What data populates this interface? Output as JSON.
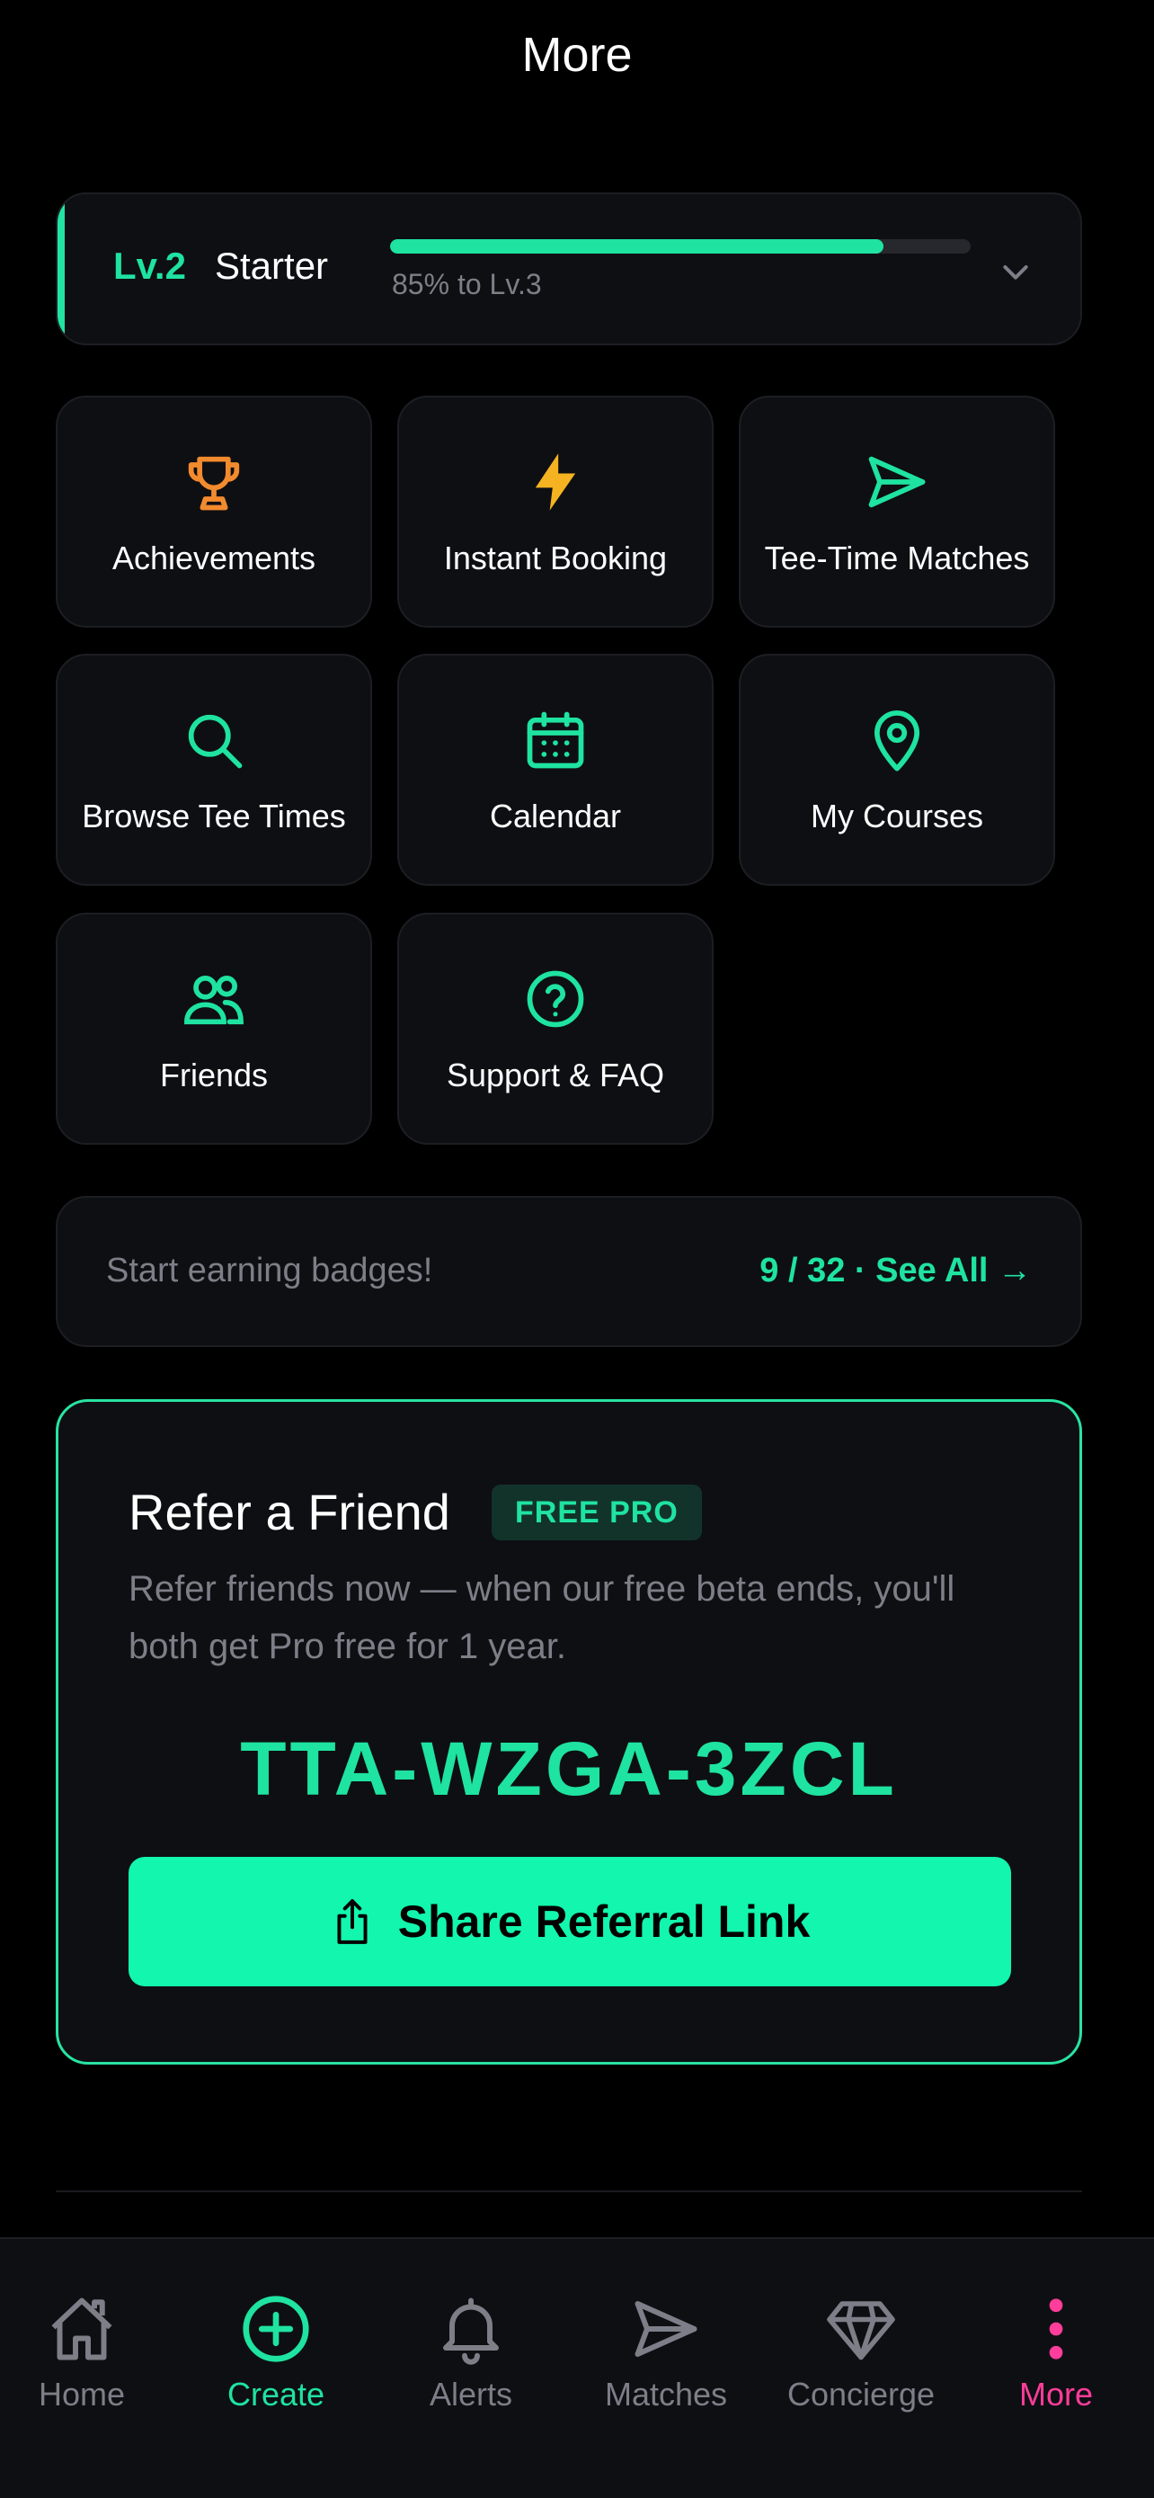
{
  "header": {
    "title": "More"
  },
  "level": {
    "level_label": "Lv.2",
    "level_name": "Starter",
    "progress_percent": 85,
    "progress_text": "85% to Lv.3"
  },
  "tiles": [
    {
      "label": "Achievements",
      "icon": "trophy-icon",
      "color": "#f28a2e"
    },
    {
      "label": "Instant Booking",
      "icon": "lightning-icon",
      "color": "#f5b321"
    },
    {
      "label": "Tee-Time Matches",
      "icon": "paper-plane-icon",
      "color": "#1fe3a0"
    },
    {
      "label": "Browse Tee Times",
      "icon": "search-icon",
      "color": "#1fe3a0"
    },
    {
      "label": "Calendar",
      "icon": "calendar-icon",
      "color": "#1fe3a0"
    },
    {
      "label": "My Courses",
      "icon": "map-pin-icon",
      "color": "#1fe3a0"
    },
    {
      "label": "Friends",
      "icon": "users-icon",
      "color": "#1fe3a0"
    },
    {
      "label": "Support & FAQ",
      "icon": "help-circle-icon",
      "color": "#1fe3a0"
    }
  ],
  "badges": {
    "text": "Start earning badges!",
    "link": "9 / 32 · See All →"
  },
  "referral": {
    "title": "Refer a Friend",
    "badge": "FREE PRO",
    "description": "Refer friends now — when our free beta ends, you'll both get Pro free for 1 year.",
    "code": "TTA-WZGA-3ZCL",
    "button_label": "Share Referral Link"
  },
  "nav": {
    "items": [
      {
        "label": "Home",
        "icon": "home-icon"
      },
      {
        "label": "Create",
        "icon": "plus-circle-icon"
      },
      {
        "label": "Alerts",
        "icon": "bell-icon"
      },
      {
        "label": "Matches",
        "icon": "paper-plane-icon"
      },
      {
        "label": "Concierge",
        "icon": "diamond-icon"
      },
      {
        "label": "More",
        "icon": "more-vertical-icon"
      }
    ],
    "active": "More"
  },
  "colors": {
    "accent": "#1fe3a0",
    "button": "#12f6ad",
    "more_active": "#ff3d9a",
    "background": "#000000",
    "card": "#0e0f13"
  }
}
